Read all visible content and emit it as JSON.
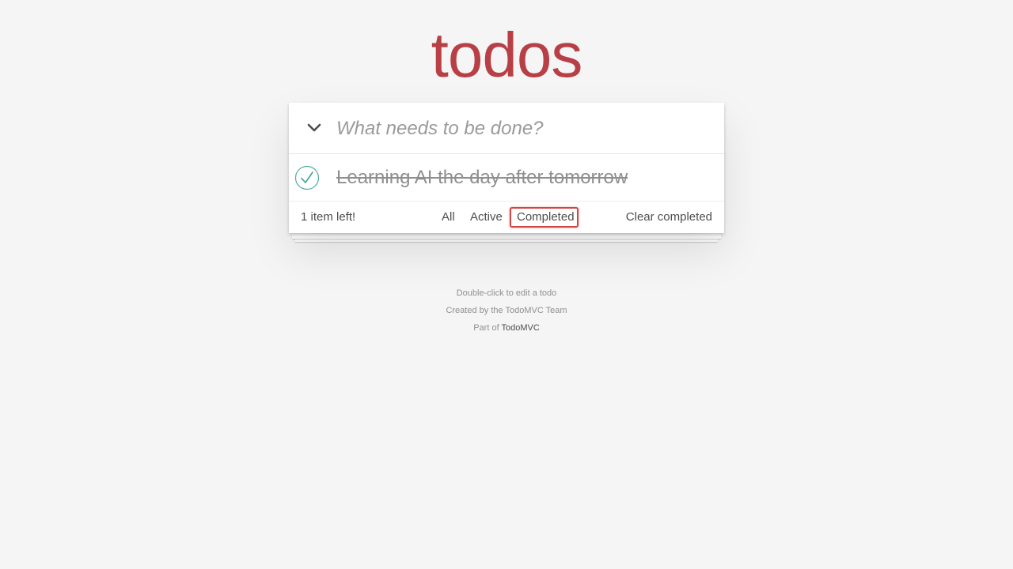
{
  "app": {
    "title": "todos"
  },
  "header": {
    "toggle_all_icon": "chevron-down-icon",
    "new_todo_placeholder": "What needs to be done?",
    "new_todo_value": ""
  },
  "todos": [
    {
      "label": "Learning AI the day after tomorrow",
      "completed": true
    }
  ],
  "footer": {
    "count_text": "1 item left!",
    "filters": [
      {
        "label": "All",
        "selected": false
      },
      {
        "label": "Active",
        "selected": false
      },
      {
        "label": "Completed",
        "selected": true
      }
    ],
    "clear_label": "Clear completed"
  },
  "info": {
    "edit_hint": "Double-click to edit a todo",
    "credit": "Created by the TodoMVC Team",
    "part_of_prefix": "Part of",
    "part_of_link": "TodoMVC"
  },
  "colors": {
    "title": "#b83f45",
    "check": "#3ea390",
    "selected_filter_border": "#ce4646"
  }
}
